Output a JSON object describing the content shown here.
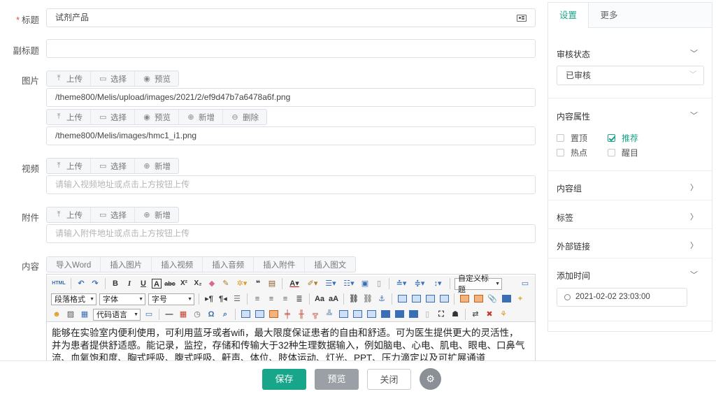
{
  "form": {
    "title_label": "标题",
    "title_value": "试剂产品",
    "subtitle_label": "副标题",
    "subtitle_value": "",
    "image_label": "图片",
    "image_group1": [
      "上传",
      "选择",
      "预览"
    ],
    "image_path1": "/theme800/Melis/upload/images/2021/2/ef9d47b7a6478a6f.png",
    "image_group2": [
      "上传",
      "选择",
      "预览",
      "新增",
      "删除"
    ],
    "image_path2": "/theme800/Melis/images/hmc1_i1.png",
    "video_label": "视频",
    "video_group": [
      "上传",
      "选择",
      "新增"
    ],
    "video_placeholder": "请输入视频地址或点击上方按钮上传",
    "attach_label": "附件",
    "attach_group": [
      "上传",
      "选择",
      "新增"
    ],
    "attach_placeholder": "请输入附件地址或点击上方按钮上传",
    "content_label": "内容",
    "content_tabs": [
      "导入Word",
      "插入图片",
      "插入视频",
      "插入音频",
      "插入附件",
      "插入图文"
    ]
  },
  "editor": {
    "custom_title": "自定义标题",
    "paragraph_format": "段落格式",
    "font_family": "字体",
    "font_size": "字号",
    "code_lang": "代码语言",
    "html_btn": "HTML",
    "body_line1": "能够在实验室内便利使用，可利用蓝牙或者wifi，最大限度保证患者的自由和舒适。可为医生提供更大的灵活性，",
    "body_line2": "并为患者提供舒适感。能记录，监控，存储和传输大于32种生理数据输入，例如脑电、心电、肌电、眼电、口鼻气",
    "body_line3": "流、血氧饱和度、胸式呼吸、腹式呼吸、鼾声、体位、肢体运动、灯光、PPT、压力滴定以及可扩展通道"
  },
  "panel": {
    "tabs": [
      "设置",
      "更多"
    ],
    "review_title": "审核状态",
    "review_value": "已审核",
    "attr_title": "内容属性",
    "attrs": [
      {
        "label": "置顶",
        "checked": false
      },
      {
        "label": "推荐",
        "checked": true
      },
      {
        "label": "热点",
        "checked": false
      },
      {
        "label": "醒目",
        "checked": false
      }
    ],
    "group_title": "内容组",
    "tags_title": "标签",
    "link_title": "外部链接",
    "time_title": "添加时间",
    "time_value": "2021-02-02 23:03:00"
  },
  "footer": {
    "save": "保存",
    "preview": "预览",
    "close": "关闭"
  },
  "colors": {
    "accent": "#17a689",
    "required": "#e74c3c",
    "preview_btn": "#9aa0a6"
  }
}
